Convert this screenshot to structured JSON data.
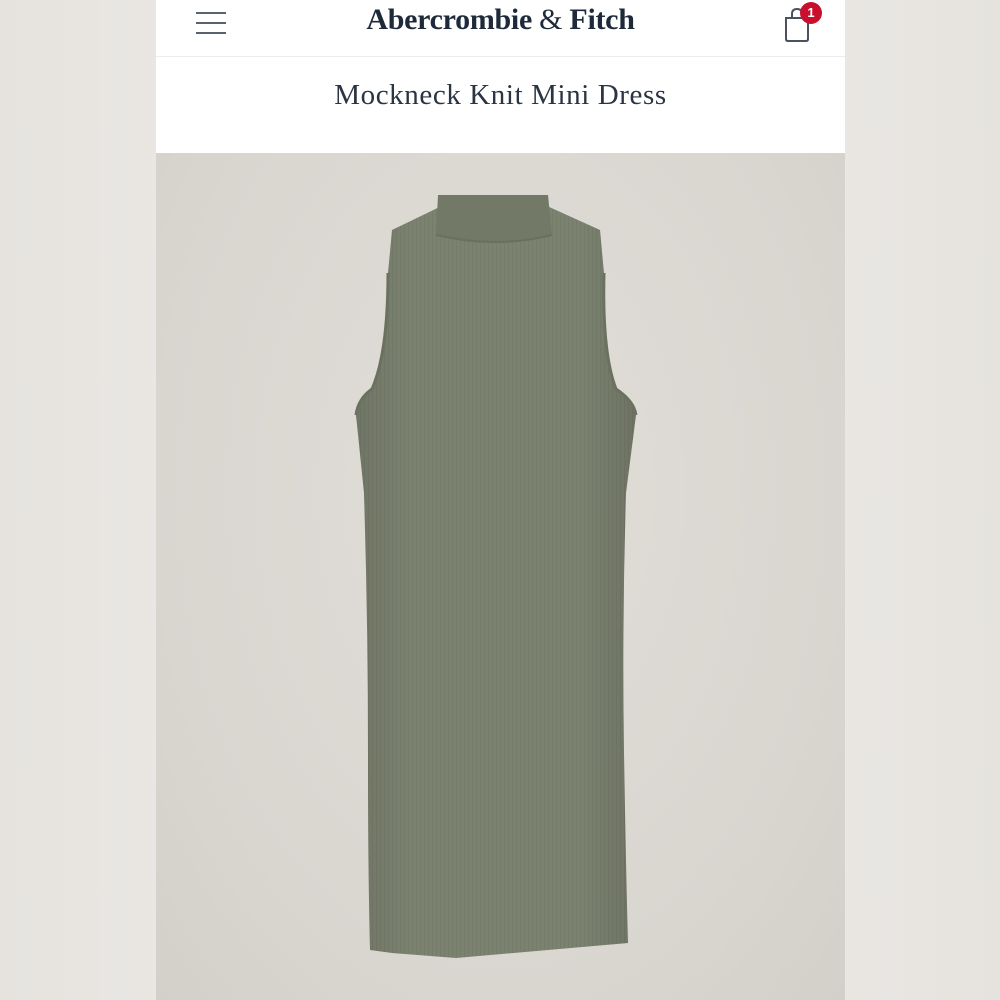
{
  "header": {
    "brand_main": "Abercrombie",
    "brand_amp": " & ",
    "brand_tail": "Fitch",
    "bag_count": "1"
  },
  "product": {
    "title": "Mockneck Knit Mini Dress",
    "image_alt": "Mockneck Knit Mini Dress in olive",
    "color": "#7c8270"
  },
  "icons": {
    "menu": "hamburger-menu-icon",
    "bag": "shopping-bag-icon"
  },
  "colors": {
    "brand_navy": "#1e2a3a",
    "badge_red": "#c8102e",
    "dress_olive": "#7c8270"
  }
}
